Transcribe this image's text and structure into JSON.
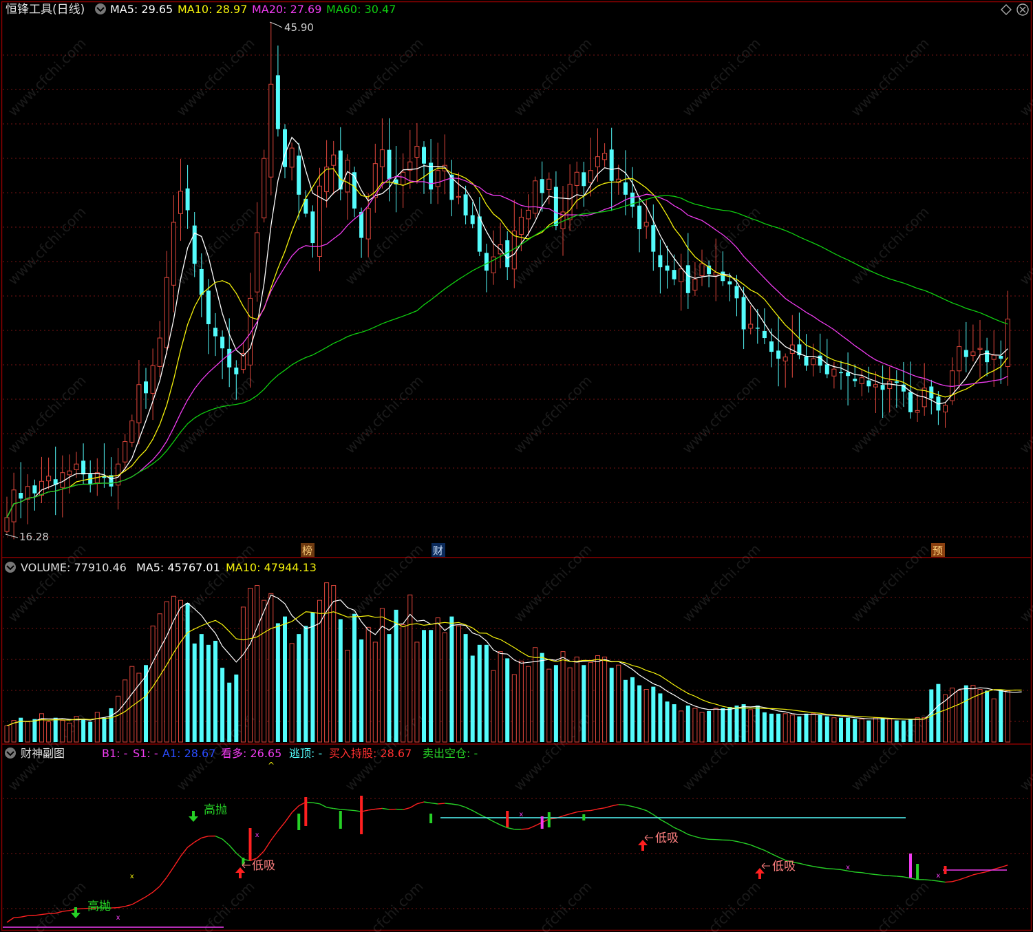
{
  "colors": {
    "bg": "#000000",
    "border": "#8b0000",
    "grid": "#7a1515",
    "up": "#e0473c",
    "down": "#54fcfc",
    "ma5": "#ffffff",
    "ma10": "#f5f20b",
    "ma20": "#f03cf0",
    "ma60": "#10d010",
    "green": "#26d026",
    "red": "#ff2020"
  },
  "main_panel": {
    "title": "恒锋工具(日线)",
    "ma5_label": "MA5: 29.65",
    "ma10_label": "MA10: 28.97",
    "ma20_label": "MA20: 27.69",
    "ma60_label": "MA60: 30.47",
    "high_label": "45.90",
    "low_label": "16.28",
    "markers": [
      "榜",
      "财",
      "预"
    ]
  },
  "volume_panel": {
    "title": "VOLUME: 77910.46",
    "ma5_label": "MA5: 45767.01",
    "ma10_label": "MA10: 47944.13"
  },
  "indicator_panel": {
    "title": "财神副图",
    "b1_label": "B1: -",
    "s1_label": "S1: -",
    "a1_label": "A1: 28.67",
    "kanduo_label": "看多: 26.65",
    "taoding_label": "逃顶: -",
    "buy_label": "买入持股: 28.67",
    "sell_label": "卖出空仓: -",
    "signals": [
      {
        "text": "高抛",
        "type": "sell"
      },
      {
        "text": "高抛",
        "type": "sell"
      },
      {
        "text": "低吸",
        "type": "buy"
      },
      {
        "text": "低吸",
        "type": "buy"
      },
      {
        "text": "低吸",
        "type": "buy"
      }
    ]
  },
  "watermark": "www.cfchi.com",
  "chart_data": [
    {
      "type": "candlestick",
      "title": "恒锋工具(日线)",
      "ylim": [
        16.28,
        45.9
      ],
      "high": 45.9,
      "low": 16.28,
      "closes": [
        17.2,
        18.8,
        18.3,
        19.0,
        18.6,
        19.3,
        19.6,
        19.1,
        19.8,
        19.9,
        20.3,
        19.7,
        19.1,
        19.8,
        19.5,
        19.0,
        20.3,
        21.6,
        22.8,
        24.9,
        24.4,
        26.0,
        27.6,
        31.1,
        34.3,
        36.1,
        35.0,
        31.9,
        30.1,
        28.4,
        27.7,
        27.0,
        25.9,
        25.5,
        26.7,
        29.9,
        33.7,
        38.0,
        42.3,
        39.7,
        37.5,
        38.6,
        35.9,
        34.8,
        33.1,
        36.4,
        37.5,
        38.2,
        36.2,
        37.9,
        35.1,
        33.4,
        35.1,
        37.7,
        38.5,
        36.8,
        36.5,
        37.2,
        37.8,
        38.7,
        37.7,
        36.2,
        37.3,
        37.6,
        35.6,
        35.8,
        34.7,
        34.2,
        32.6,
        31.5,
        32.3,
        33.0,
        31.7,
        33.8,
        34.6,
        35.0,
        36.7,
        36.0,
        36.8,
        34.1,
        34.9,
        36.5,
        37.2,
        36.4,
        37.3,
        38.1,
        38.3,
        36.7,
        36.8,
        35.9,
        35.2,
        33.9,
        34.3,
        32.6,
        31.7,
        31.5,
        31.0,
        31.6,
        30.2,
        31.0,
        31.9,
        31.3,
        31.4,
        30.9,
        30.7,
        29.9,
        28.1,
        28.4,
        28.2,
        27.6,
        26.8,
        26.4,
        26.5,
        27.2,
        26.6,
        26.0,
        26.4,
        26.0,
        25.5,
        25.8,
        25.6,
        25.4,
        25.1,
        25.3,
        24.8,
        24.9,
        24.6,
        25.1,
        25.0,
        24.5,
        23.3,
        23.4,
        24.7,
        24.1,
        23.4,
        23.7,
        25.7,
        27.1,
        26.5,
        26.8,
        27.0,
        26.2,
        26.6,
        26.4,
        28.7
      ],
      "ma5": 29.65,
      "ma10": 28.97,
      "ma20": 27.69,
      "ma60": 30.47,
      "markers": [
        "榜",
        "财",
        "预"
      ]
    },
    {
      "type": "bar",
      "title": "VOLUME",
      "last": 77910.46,
      "ma5": 45767.01,
      "ma10": 47944.13,
      "values": [
        12000,
        16000,
        18000,
        15000,
        17000,
        21000,
        15000,
        18000,
        16000,
        14000,
        19000,
        17000,
        15000,
        22000,
        18000,
        25000,
        34000,
        46000,
        56000,
        51000,
        57000,
        86000,
        95000,
        104000,
        108000,
        105000,
        103000,
        73000,
        80000,
        72000,
        75000,
        55000,
        44000,
        50000,
        100000,
        114000,
        116000,
        105000,
        110000,
        88000,
        93000,
        73000,
        80000,
        86000,
        96000,
        105000,
        118000,
        116000,
        91000,
        68000,
        95000,
        76000,
        85000,
        74000,
        99000,
        80000,
        98000,
        87000,
        109000,
        74000,
        83000,
        83000,
        92000,
        81000,
        93000,
        86000,
        80000,
        64000,
        72000,
        72000,
        53000,
        67000,
        62000,
        50000,
        60000,
        56000,
        70000,
        66000,
        54000,
        57000,
        67000,
        55000,
        63000,
        57000,
        59000,
        64000,
        63000,
        55000,
        57000,
        46000,
        48000,
        42000,
        39000,
        41000,
        36000,
        30000,
        28000,
        23000,
        27000,
        25000,
        22000,
        23000,
        25000,
        25000,
        26000,
        27000,
        28000,
        24000,
        27000,
        22000,
        21000,
        21000,
        21000,
        20000,
        19000,
        21000,
        21000,
        20000,
        19000,
        18000,
        18000,
        18000,
        17000,
        17000,
        16000,
        18000,
        18000,
        17000,
        16000,
        16000,
        17000,
        18000,
        18000,
        39000,
        43000,
        35000,
        40000,
        38000,
        42000,
        42000,
        39000,
        38000,
        32000,
        39000,
        38000,
        37000,
        40000
      ]
    }
  ]
}
